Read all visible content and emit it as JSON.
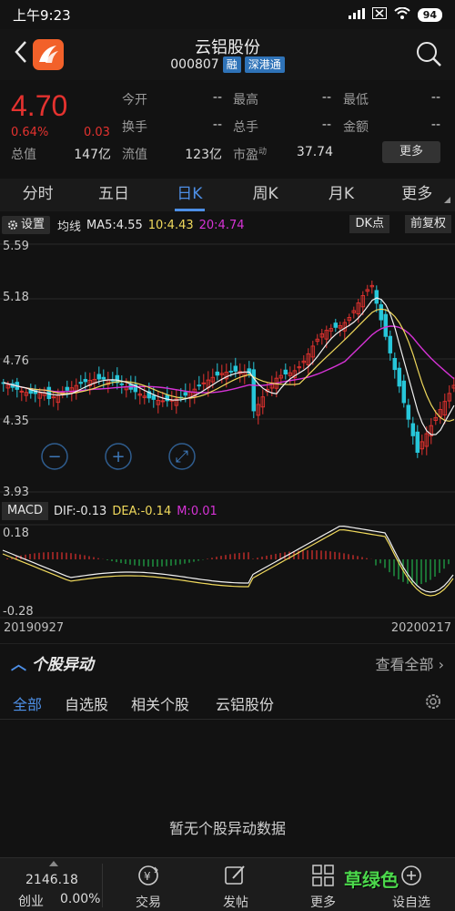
{
  "status_bar": {
    "time": "上午9:23",
    "battery": "94"
  },
  "header": {
    "stock_name": "云铝股份",
    "stock_code": "000807",
    "tags": [
      "融",
      "深港通"
    ]
  },
  "quote": {
    "price": "4.70",
    "change_pct": "0.64%",
    "change": "0.03",
    "open_label": "今开",
    "open": "--",
    "high_label": "最高",
    "high": "--",
    "low_label": "最低",
    "low": "--",
    "turnover_label": "换手",
    "turnover": "--",
    "volume_label": "总手",
    "volume": "--",
    "amount_label": "金额",
    "amount": "--",
    "mcap_label": "总值",
    "mcap": "147亿",
    "float_label": "流值",
    "float": "123亿",
    "pe_label": "市盈",
    "pe_sup": "动",
    "pe": "37.74",
    "more_label": "更多",
    "colors": {
      "up": "#e4322f"
    }
  },
  "period_tabs": [
    "分时",
    "五日",
    "日K",
    "周K",
    "月K",
    "更多"
  ],
  "active_tab": "日K",
  "indicators": {
    "settings_label": "设置",
    "ma_label": "均线",
    "ma5": "MA5:4.55",
    "ma10": "10:4.43",
    "ma20": "20:4.74",
    "dk_label": "DK点",
    "adjust_label": "前复权",
    "macd_label": "MACD",
    "dif": "DIF:-0.13",
    "dea": "DEA:-0.14",
    "m": "M:0.01"
  },
  "chart_data": {
    "type": "candlestick",
    "price_axis_labels": [
      "5.59",
      "5.18",
      "4.76",
      "4.35",
      "3.93"
    ],
    "macd_axis_labels": [
      "0.18",
      "-0.28"
    ],
    "start_date": "20190927",
    "end_date": "20200217",
    "ylim": [
      3.93,
      5.59
    ]
  },
  "alerts": {
    "title": "个股异动",
    "view_all": "查看全部",
    "tabs": [
      "全部",
      "自选股",
      "相关个股",
      "云铝股份"
    ],
    "empty_text": "暂无个股异动数据"
  },
  "bottom_bar": {
    "index_value": "2146.18",
    "index_name": "创业",
    "index_change": "0.00%",
    "items": [
      "交易",
      "发帖",
      "更多",
      "设自选"
    ]
  },
  "watermark": "草绿色"
}
